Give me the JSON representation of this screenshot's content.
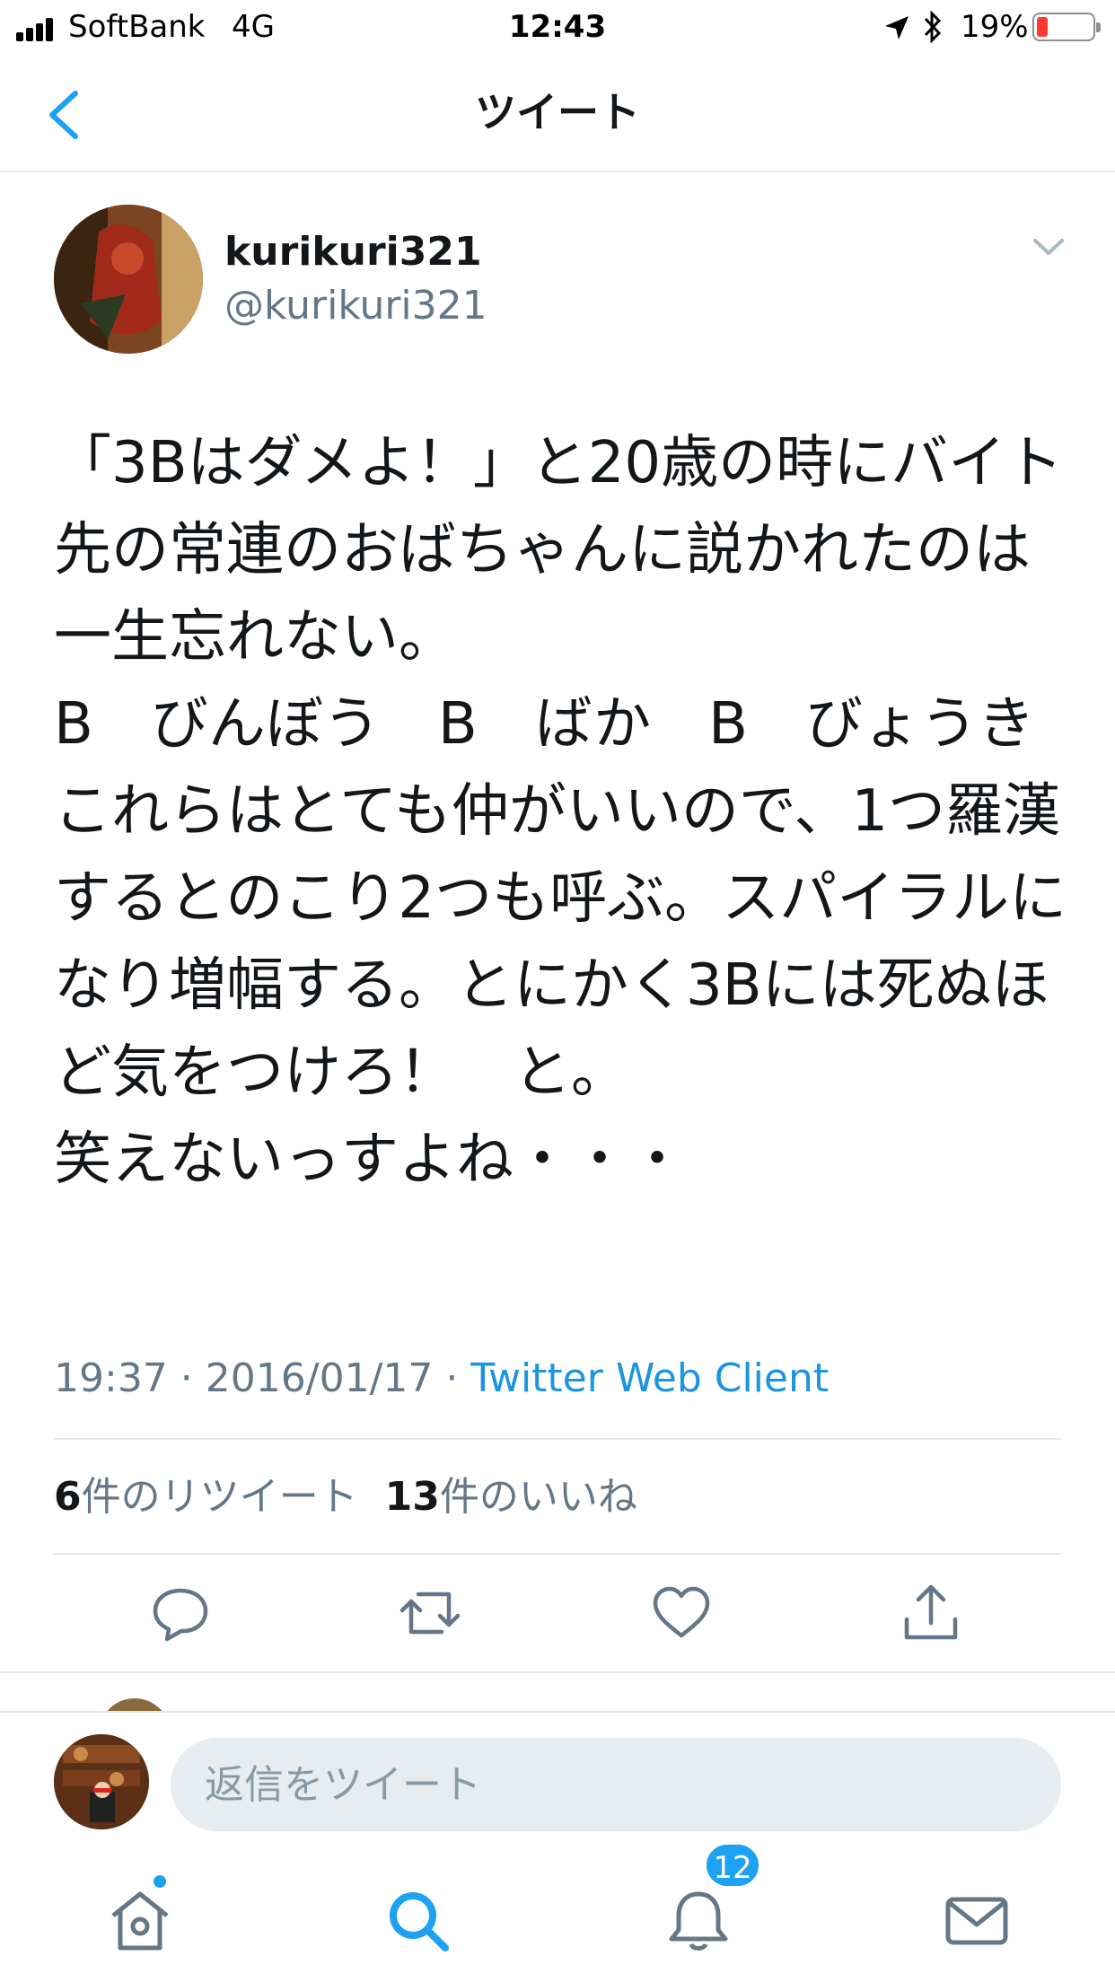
{
  "status_bar": {
    "carrier": "SoftBank",
    "network": "4G",
    "time": "12:43",
    "battery": "19%"
  },
  "nav": {
    "title": "ツイート"
  },
  "tweet": {
    "display_name": "kurikuri321",
    "handle": "@kurikuri321",
    "text": "「3Bはダメよ！」と20歳の時にバイト先の常連のおばちゃんに説かれたのは一生忘れない。\nB　びんぼう　B　ばか　B　びょうき\nこれらはとても仲がいいので、1つ羅漢するとのこり2つも呼ぶ。スパイラルになり増幅する。とにかく3Bには死ぬほど気をつけろ！　と。\n笑えないっすよね・・・",
    "time": "19:37",
    "date": "2016/01/17",
    "client": "Twitter Web Client",
    "retweet_count": "6",
    "retweet_label": "件のリツイート",
    "like_count": "13",
    "like_label": "件のいいね"
  },
  "reply": {
    "placeholder": "返信をツイート"
  },
  "tab_bar": {
    "notifications_badge": "12"
  },
  "colors": {
    "accent": "#1da1f2",
    "link": "#1b95e0",
    "secondary_text": "#657786",
    "divider": "#e1e8ed"
  }
}
